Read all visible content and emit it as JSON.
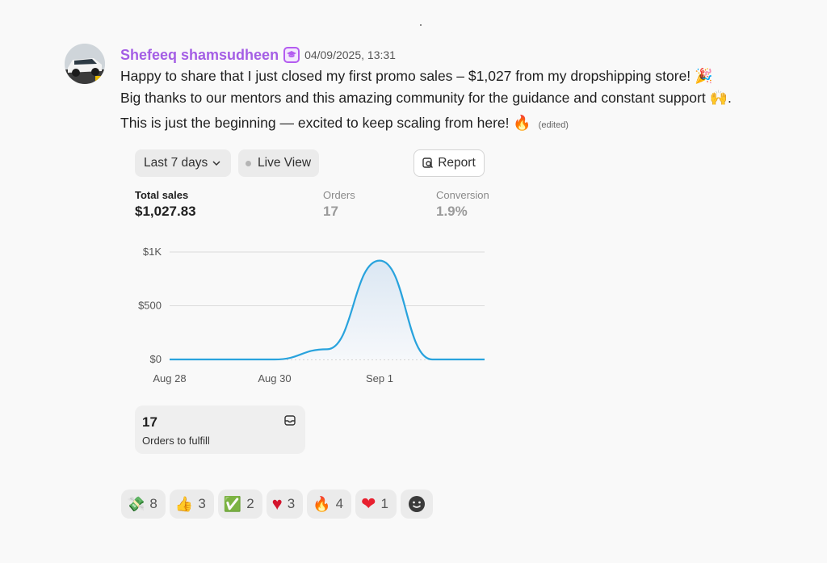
{
  "message": {
    "username": "Shefeeq shamsudheen",
    "timestamp": "04/09/2025, 13:31",
    "line1": "Happy to share that I just closed my first promo sales – $1,027 from my dropshipping store!",
    "line1_emoji": "🎉",
    "line2": "Big thanks to our mentors and this amazing community for the guidance and constant support",
    "line2_emoji": "🙌",
    "line2_end": ".",
    "line3": "This is just the beginning — excited to keep scaling from here!",
    "line3_emoji": "🔥",
    "edited": "(edited)"
  },
  "dashboard": {
    "range_label": "Last 7 days",
    "live_label": "Live View",
    "report_label": "Report",
    "metrics": [
      {
        "label": "Total sales",
        "value": "$1,027.83"
      },
      {
        "label": "Orders",
        "value": "17"
      },
      {
        "label": "Conversion",
        "value": "1.9%"
      }
    ],
    "fulfill_count": "17",
    "fulfill_label": "Orders to fulfill"
  },
  "chart_data": {
    "type": "area",
    "x": [
      "Aug 28",
      "Aug 29",
      "Aug 30",
      "Aug 31",
      "Sep 1",
      "Sep 2",
      "Sep 3"
    ],
    "values": [
      0,
      0,
      0,
      95,
      920,
      0,
      0
    ],
    "xticks": [
      "Aug 28",
      "Aug 30",
      "Sep 1"
    ],
    "yticks": [
      "$0",
      "$500",
      "$1K"
    ],
    "ylim": [
      0,
      1000
    ],
    "grid": true,
    "line_color": "#29a3dd"
  },
  "reactions": [
    {
      "emoji": "💸",
      "count": "8"
    },
    {
      "emoji": "👍",
      "count": "3"
    },
    {
      "emoji": "✅",
      "count": "2"
    },
    {
      "emoji": "♥",
      "count": "3",
      "color": "#d4142d"
    },
    {
      "emoji": "🔥",
      "count": "4"
    },
    {
      "emoji": "❤",
      "count": "1",
      "color": "#e8202f"
    }
  ]
}
